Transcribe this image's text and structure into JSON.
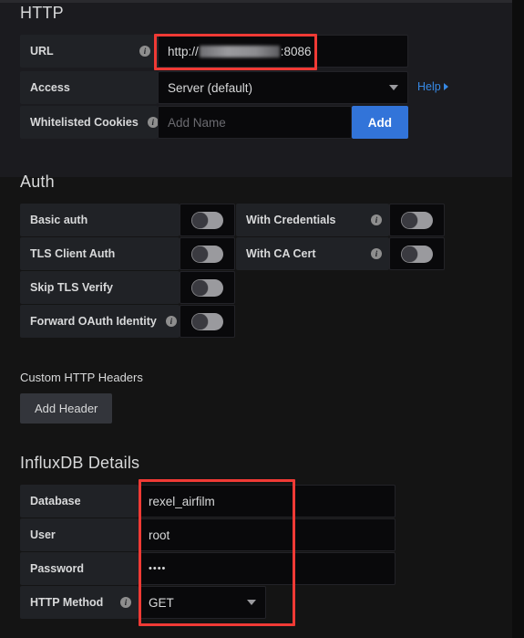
{
  "http": {
    "heading": "HTTP",
    "rows": [
      {
        "label": "URL",
        "has_info": true,
        "value_prefix": "http://",
        "value_suffix": ":8086",
        "redacted": true
      },
      {
        "label": "Access",
        "has_info": false,
        "value": "Server (default)"
      },
      {
        "label": "Whitelisted Cookies",
        "has_info": true,
        "placeholder": "Add Name",
        "button": "Add"
      }
    ],
    "help_label": "Help"
  },
  "auth": {
    "heading": "Auth",
    "left_rows": [
      {
        "label": "Basic auth",
        "has_info": false,
        "toggle": "off"
      },
      {
        "label": "TLS Client Auth",
        "has_info": false,
        "toggle": "off"
      },
      {
        "label": "Skip TLS Verify",
        "has_info": false,
        "toggle": "off"
      },
      {
        "label": "Forward OAuth Identity",
        "has_info": true,
        "toggle": "off"
      }
    ],
    "right_rows": [
      {
        "label": "With Credentials",
        "has_info": true,
        "toggle": "off"
      },
      {
        "label": "With CA Cert",
        "has_info": true,
        "toggle": "off"
      }
    ]
  },
  "custom_headers": {
    "heading": "Custom HTTP Headers",
    "add_header_label": "Add Header"
  },
  "influxdb": {
    "heading": "InfluxDB Details",
    "rows": [
      {
        "label": "Database",
        "has_info": false,
        "value": "rexel_airfilm"
      },
      {
        "label": "User",
        "has_info": false,
        "value": "root"
      },
      {
        "label": "Password",
        "has_info": false,
        "value": "••••",
        "masked": true
      },
      {
        "label": "HTTP Method",
        "has_info": true,
        "value": "GET",
        "is_select": true
      }
    ]
  },
  "annotations": {
    "highlight_color": "#f03a35",
    "boxes": [
      {
        "name": "url-field-highlight"
      },
      {
        "name": "influxdb-fields-highlight"
      }
    ]
  }
}
